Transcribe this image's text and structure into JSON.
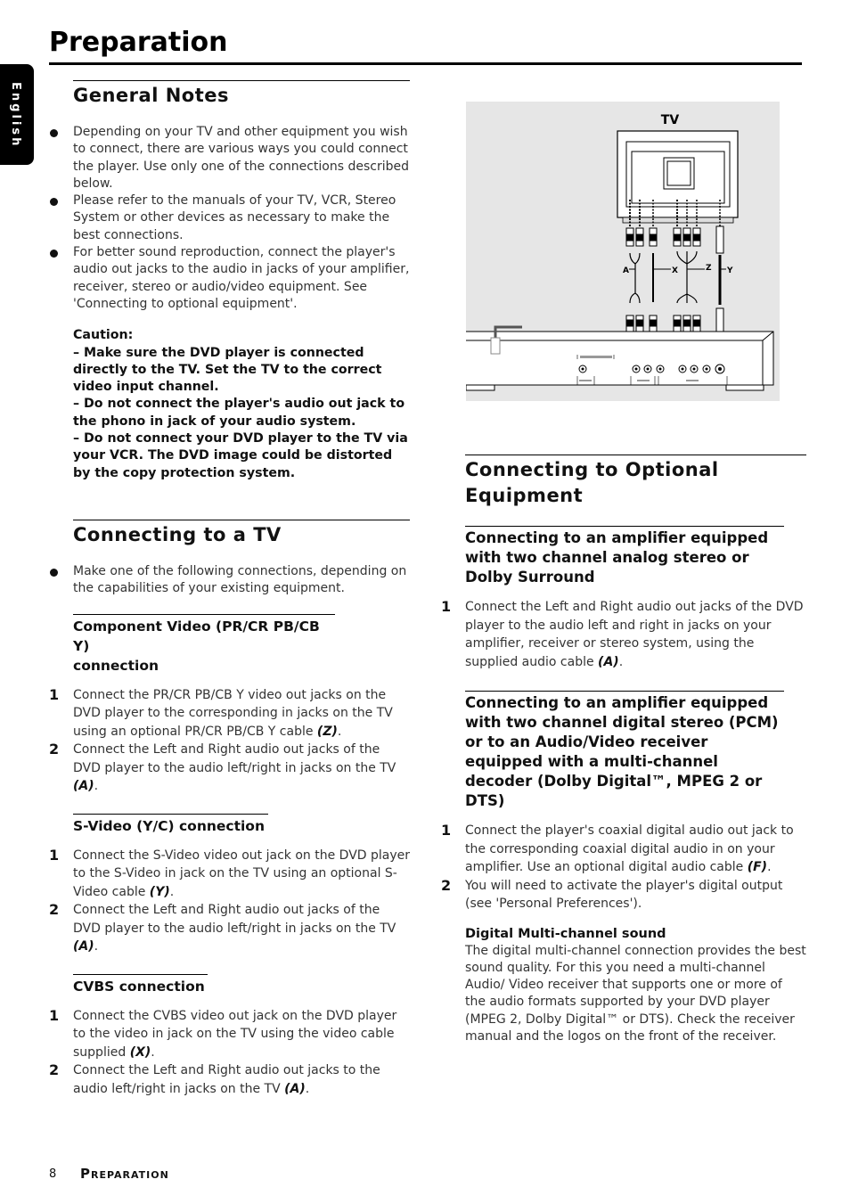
{
  "page": {
    "title": "Preparation",
    "language_tab": "English",
    "footer_page_number": "8",
    "footer_title": "Preparation"
  },
  "general_notes": {
    "heading": "General Notes",
    "bullets": [
      "Depending on your TV and other equipment you wish to connect, there are various ways you could connect the player. Use only one of the connections described below.",
      "Please refer to the manuals of your TV, VCR, Stereo System or other devices as necessary to make the best connections.",
      "For better sound reproduction, connect the player's audio out jacks to the audio in jacks of your amplifier, receiver, stereo or audio/video equipment. See 'Connecting to optional equipment'."
    ],
    "caution": {
      "label": "Caution:",
      "items": [
        "– Make sure the DVD player is connected directly to the TV. Set the TV to the correct video input channel.",
        "– Do not connect  the player's audio out jack to the phono in jack of your audio system.",
        "– Do not connect your DVD player to the TV via your VCR. The DVD image could be distorted by the copy protection system."
      ]
    }
  },
  "connecting_tv": {
    "heading": "Connecting to a TV",
    "bullet": "Make one of the following connections, depending on the capabilities of your existing equipment.",
    "component": {
      "heading_line1": "Component Video (PR/CR PB/CB Y)",
      "heading_line2": "connection",
      "steps": [
        {
          "num": "1",
          "text": "Connect the PR/CR PB/CB Y video out jacks on the DVD player to the corresponding in jacks on the TV using an optional PR/CR PB/CB Y cable",
          "ref": "(Z)"
        },
        {
          "num": "2",
          "text": "Connect the Left and Right audio out jacks of the DVD player to the audio left/right in jacks on the TV",
          "ref": "(A)"
        }
      ]
    },
    "svideo": {
      "heading": "S-Video (Y/C) connection",
      "steps": [
        {
          "num": "1",
          "text": "Connect the S-Video video out jack on the DVD player to the S-Video in jack on the TV using an optional S-Video cable",
          "ref": "(Y)"
        },
        {
          "num": "2",
          "text": "Connect the Left and Right audio out jacks of the DVD player to the audio left/right in jacks on the TV",
          "ref": "(A)"
        }
      ]
    },
    "cvbs": {
      "heading": "CVBS connection",
      "steps": [
        {
          "num": "1",
          "text": "Connect the CVBS video out jack on the DVD player to the video in jack on the TV using the video cable supplied",
          "ref": "(X)"
        },
        {
          "num": "2",
          "text": "Connect the Left and Right audio out jacks to the audio left/right in jacks on the TV",
          "ref": "(A)"
        }
      ]
    }
  },
  "diagram": {
    "tv_label": "TV",
    "cable_labels": [
      "A",
      "X",
      "Z",
      "Y"
    ]
  },
  "optional_equipment": {
    "heading": "Connecting to Optional Equipment",
    "analog": {
      "heading": "Connecting to an amplifier equipped with two channel analog stereo or Dolby Surround",
      "steps": [
        {
          "num": "1",
          "text": "Connect the Left and Right audio out jacks of the DVD player to the audio left and right in jacks on your amplifier, receiver or stereo system, using the supplied audio cable",
          "ref": "(A)"
        }
      ]
    },
    "digital": {
      "heading": "Connecting to an amplifier equipped with two channel digital stereo (PCM) or to an Audio/Video receiver equipped with a multi-channel decoder (Dolby Digital™, MPEG 2 or DTS)",
      "steps": [
        {
          "num": "1",
          "text": "Connect the player's coaxial digital audio out jack to the corresponding coaxial digital audio in on your amplifier. Use an optional digital audio cable",
          "ref": "(F)"
        },
        {
          "num": "2",
          "text": "You will need to activate the player's digital output (see 'Personal Preferences').",
          "ref": ""
        }
      ],
      "subheading": "Digital Multi-channel sound",
      "body": "The digital multi-channel connection provides the best sound quality. For this you need a multi-channel Audio/ Video receiver that supports one or more of the audio formats supported by your DVD player (MPEG 2, Dolby Digital™ or DTS). Check the receiver manual and the logos on the front of the receiver."
    }
  }
}
